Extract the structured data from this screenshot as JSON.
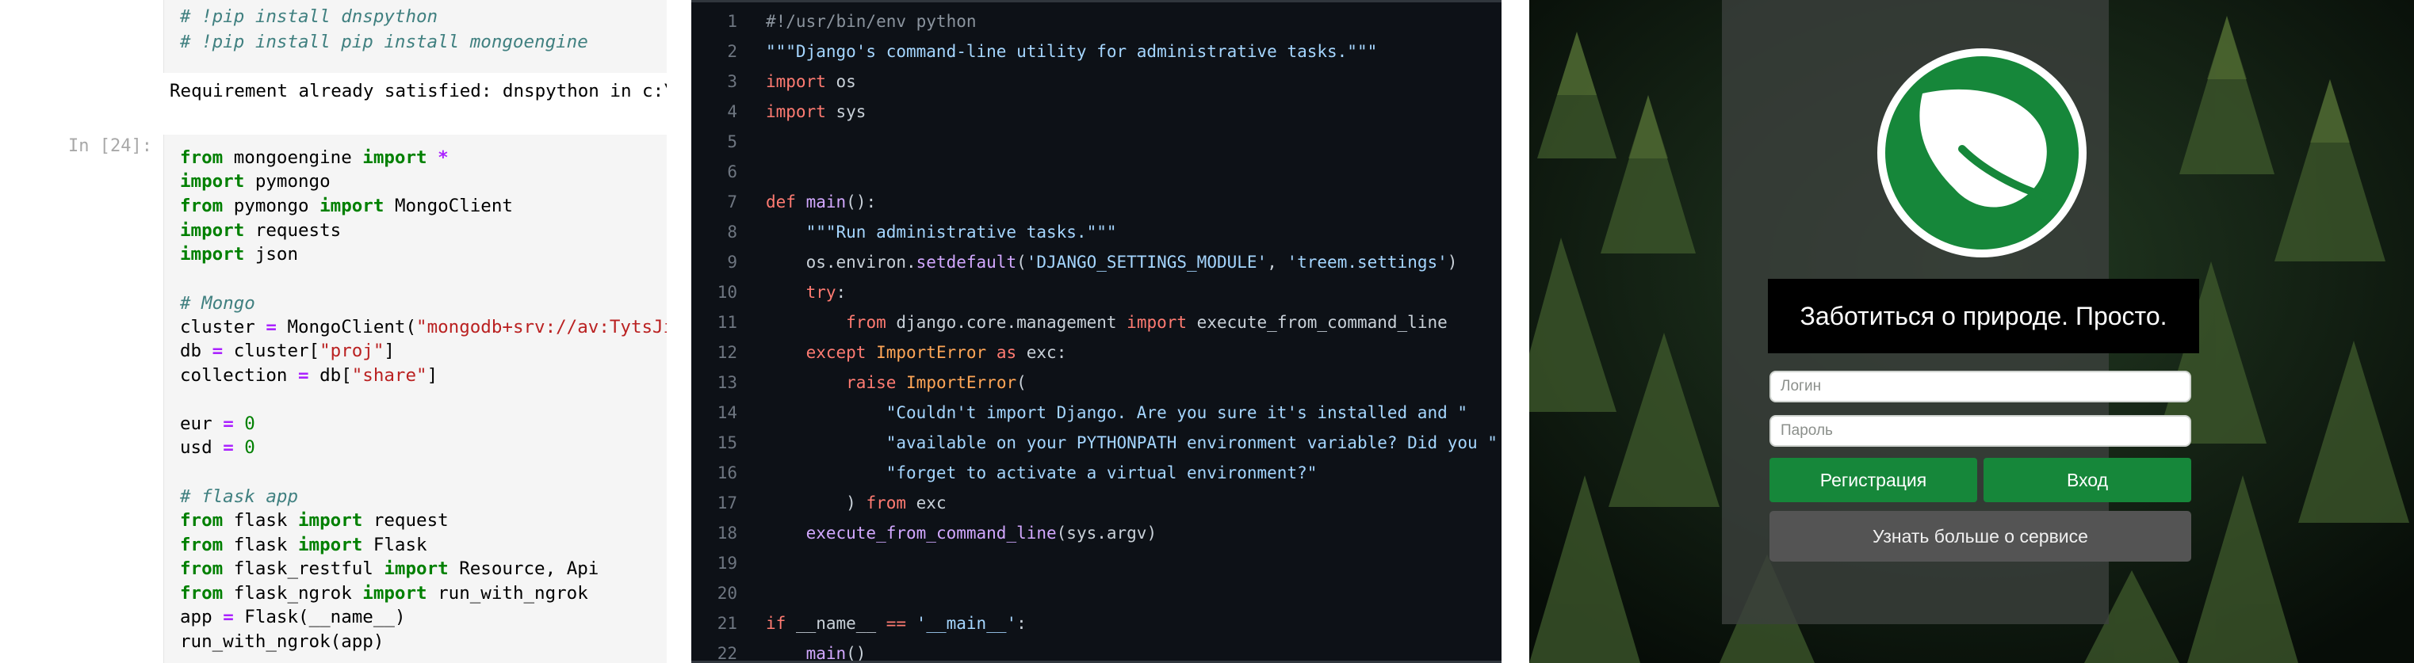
{
  "notebook": {
    "top_cell_lines": [
      "# !pip install dnspython",
      "# !pip install pip install mongoengine"
    ],
    "output_text": "Requirement already satisfied: dnspython in c:\\",
    "prompt": "In [24]:",
    "code": {
      "l1": [
        "from",
        "mongoengine",
        "import",
        "*"
      ],
      "l2": [
        "import",
        "pymongo"
      ],
      "l3": [
        "from",
        "pymongo",
        "import",
        "MongoClient"
      ],
      "l4": [
        "import",
        "requests"
      ],
      "l5": [
        "import",
        "json"
      ],
      "l6": "# Mongo",
      "l7": [
        "cluster",
        "=",
        "MongoClient(",
        "\"mongodb+srv://av:TytsJi"
      ],
      "l8": [
        "db",
        "=",
        "cluster[",
        "\"proj\"",
        "]"
      ],
      "l9": [
        "collection",
        "=",
        "db[",
        "\"share\"",
        "]"
      ],
      "l10": [
        "eur",
        "=",
        "0"
      ],
      "l11": [
        "usd",
        "=",
        "0"
      ],
      "l12": "# flask app",
      "l13": [
        "from",
        "flask",
        "import",
        "request"
      ],
      "l14": [
        "from",
        "flask",
        "import",
        "Flask"
      ],
      "l15": [
        "from",
        "flask_restful",
        "import",
        "Resource",
        ",",
        "Api"
      ],
      "l16": [
        "from",
        "flask_ngrok",
        "import",
        "run_with_ngrok"
      ],
      "l17": [
        "app",
        "=",
        "Flask(",
        "__name__",
        ")"
      ],
      "l18": [
        "run_with_ngrok(",
        "app",
        ")"
      ]
    }
  },
  "editor": {
    "line_numbers": [
      "1",
      "2",
      "3",
      "4",
      "5",
      "6",
      "7",
      "8",
      "9",
      "10",
      "11",
      "12",
      "13",
      "14",
      "15",
      "16",
      "17",
      "18",
      "19",
      "20",
      "21",
      "22"
    ],
    "lines": {
      "l1": "#!/usr/bin/env python",
      "l2": "\"\"\"Django's command-line utility for administrative tasks.\"\"\"",
      "l3": [
        "import",
        " os"
      ],
      "l4": [
        "import",
        " sys"
      ],
      "l7": [
        "def",
        " ",
        "main",
        "():"
      ],
      "l8": "    \"\"\"Run administrative tasks.\"\"\"",
      "l9": [
        "    os.environ.",
        "setdefault",
        "(",
        "'DJANGO_SETTINGS_MODULE'",
        ", ",
        "'treem.settings'",
        ")"
      ],
      "l10": [
        "    ",
        "try",
        ":"
      ],
      "l11": [
        "        ",
        "from",
        " django.core.management ",
        "import",
        " execute_from_command_line"
      ],
      "l12": [
        "    ",
        "except",
        " ",
        "ImportError",
        " ",
        "as",
        " exc:"
      ],
      "l13": [
        "        ",
        "raise",
        " ",
        "ImportError",
        "("
      ],
      "l14": "            \"Couldn't import Django. Are you sure it's installed and \"",
      "l15": "            \"available on your PYTHONPATH environment variable? Did you \"",
      "l16": "            \"forget to activate a virtual environment?\"",
      "l17": [
        "        ) ",
        "from",
        " exc"
      ],
      "l18": [
        "    ",
        "execute_from_command_line",
        "(sys.argv)"
      ],
      "l21": [
        "if",
        " __name__ ",
        "==",
        " ",
        "'__main__'",
        ":"
      ],
      "l22": [
        "    ",
        "main",
        "()"
      ]
    }
  },
  "login": {
    "tagline": "Заботиться о природе. Просто.",
    "login_placeholder": "Логин",
    "password_placeholder": "Пароль",
    "register_label": "Регистрация",
    "signin_label": "Вход",
    "more_label": "Узнать больше о сервисе",
    "logo_icon": "leaf-icon",
    "accent_color": "#16873a"
  }
}
